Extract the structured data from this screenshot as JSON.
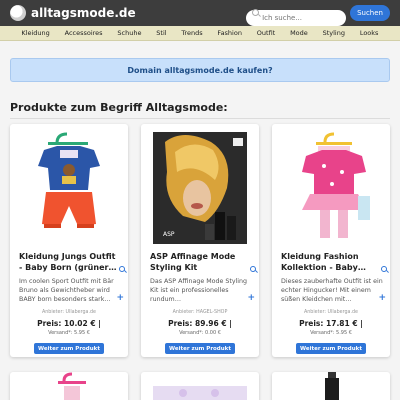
{
  "header": {
    "brand": "alltagsmode.de",
    "search_placeholder": "Ich suche...",
    "search_button": "Suchen"
  },
  "nav": [
    "Kleidung",
    "Accessoires",
    "Schuhe",
    "Stil",
    "Trends",
    "Fashion",
    "Outfit",
    "Mode",
    "Styling",
    "Looks"
  ],
  "banner": "Domain alltagsmode.de kaufen?",
  "section_title": "Produkte zum Begriff Alltagsmode:",
  "products": [
    {
      "title": "Kleidung Jungs Outfit - Baby Born (grüner…",
      "desc": "Im coolen Sport Outfit mit Bär Bruno als Gewichtheber wird BABY born besonders stark…",
      "seller": "Anbieter: Ullaberga.de",
      "price": "Preis: 10.02 € |",
      "shipping": "Versand*: 5.95 €",
      "cta": "Weiter zum Produkt"
    },
    {
      "title": "ASP Affinage Mode Styling Kit",
      "desc": "Das ASP Affinage Mode Styling Kit ist ein professionelles rundum…",
      "seller": "Anbieter: HAGEL-SHOP",
      "price": "Preis: 89.96 € |",
      "shipping": "Versand*: 0.00 €",
      "cta": "Weiter zum Produkt"
    },
    {
      "title": "Kleidung Fashion Kollektion - Baby…",
      "desc": "Dieses zauberhafte Outfit ist ein echter Hingucker! Mit einem süßen Kleidchen mit…",
      "seller": "Anbieter: Ullaberga.de",
      "price": "Preis: 17.81 € |",
      "shipping": "Versand*: 5.95 €",
      "cta": "Weiter zum Produkt"
    }
  ],
  "icons": {
    "logo": "logo-icon",
    "search": "search-icon",
    "zoom": "magnifier-icon",
    "more": "plus-icon"
  },
  "colors": {
    "topbar": "#3d3d3d",
    "nav": "#e9e6c5",
    "accent": "#2f75d8",
    "banner": "#c8e0fb"
  }
}
